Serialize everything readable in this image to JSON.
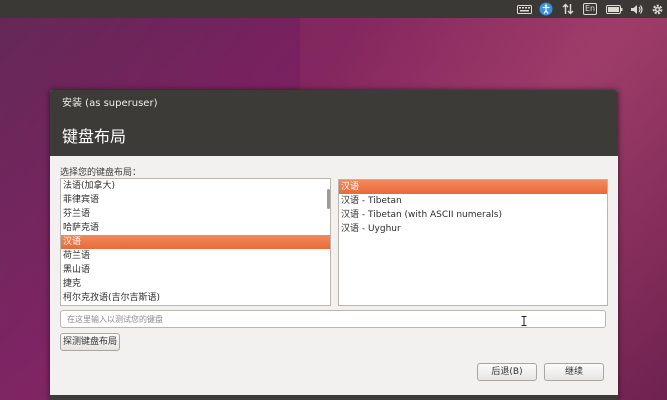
{
  "top_panel": {
    "keyboard_icon": "keyboard-icon",
    "accessibility_icon": "accessibility-icon",
    "network_icon": "network-arrows-icon",
    "input_method_label": "En",
    "battery_icon": "battery-icon",
    "volume_icon": "volume-icon",
    "settings_icon": "gear-icon"
  },
  "window": {
    "title": "安装 (as superuser)",
    "heading": "键盘布局"
  },
  "layout_prompt": "选择您的键盘布局：",
  "layouts": [
    {
      "label": "法语(加拿大)",
      "selected": false
    },
    {
      "label": "菲律宾语",
      "selected": false
    },
    {
      "label": "芬兰语",
      "selected": false
    },
    {
      "label": "哈萨克语",
      "selected": false
    },
    {
      "label": "汉语",
      "selected": true
    },
    {
      "label": "荷兰语",
      "selected": false
    },
    {
      "label": "黑山语",
      "selected": false
    },
    {
      "label": "捷克",
      "selected": false
    },
    {
      "label": "柯尔克孜语(吉尔吉斯语)",
      "selected": false
    }
  ],
  "variants": [
    {
      "label": "汉语",
      "selected": true
    },
    {
      "label": "汉语 - Tibetan",
      "selected": false
    },
    {
      "label": "汉语 - Tibetan (with ASCII numerals)",
      "selected": false
    },
    {
      "label": "汉语 - Uyghur",
      "selected": false
    }
  ],
  "test_input": {
    "placeholder": "在这里输入以测试您的键盘",
    "value": ""
  },
  "buttons": {
    "detect": "探测键盘布局",
    "back": "后退(B)",
    "continue": "继续"
  },
  "colors": {
    "selection": "#e9693a",
    "titlebar": "#3c3b37",
    "panel": "#3b3936"
  }
}
